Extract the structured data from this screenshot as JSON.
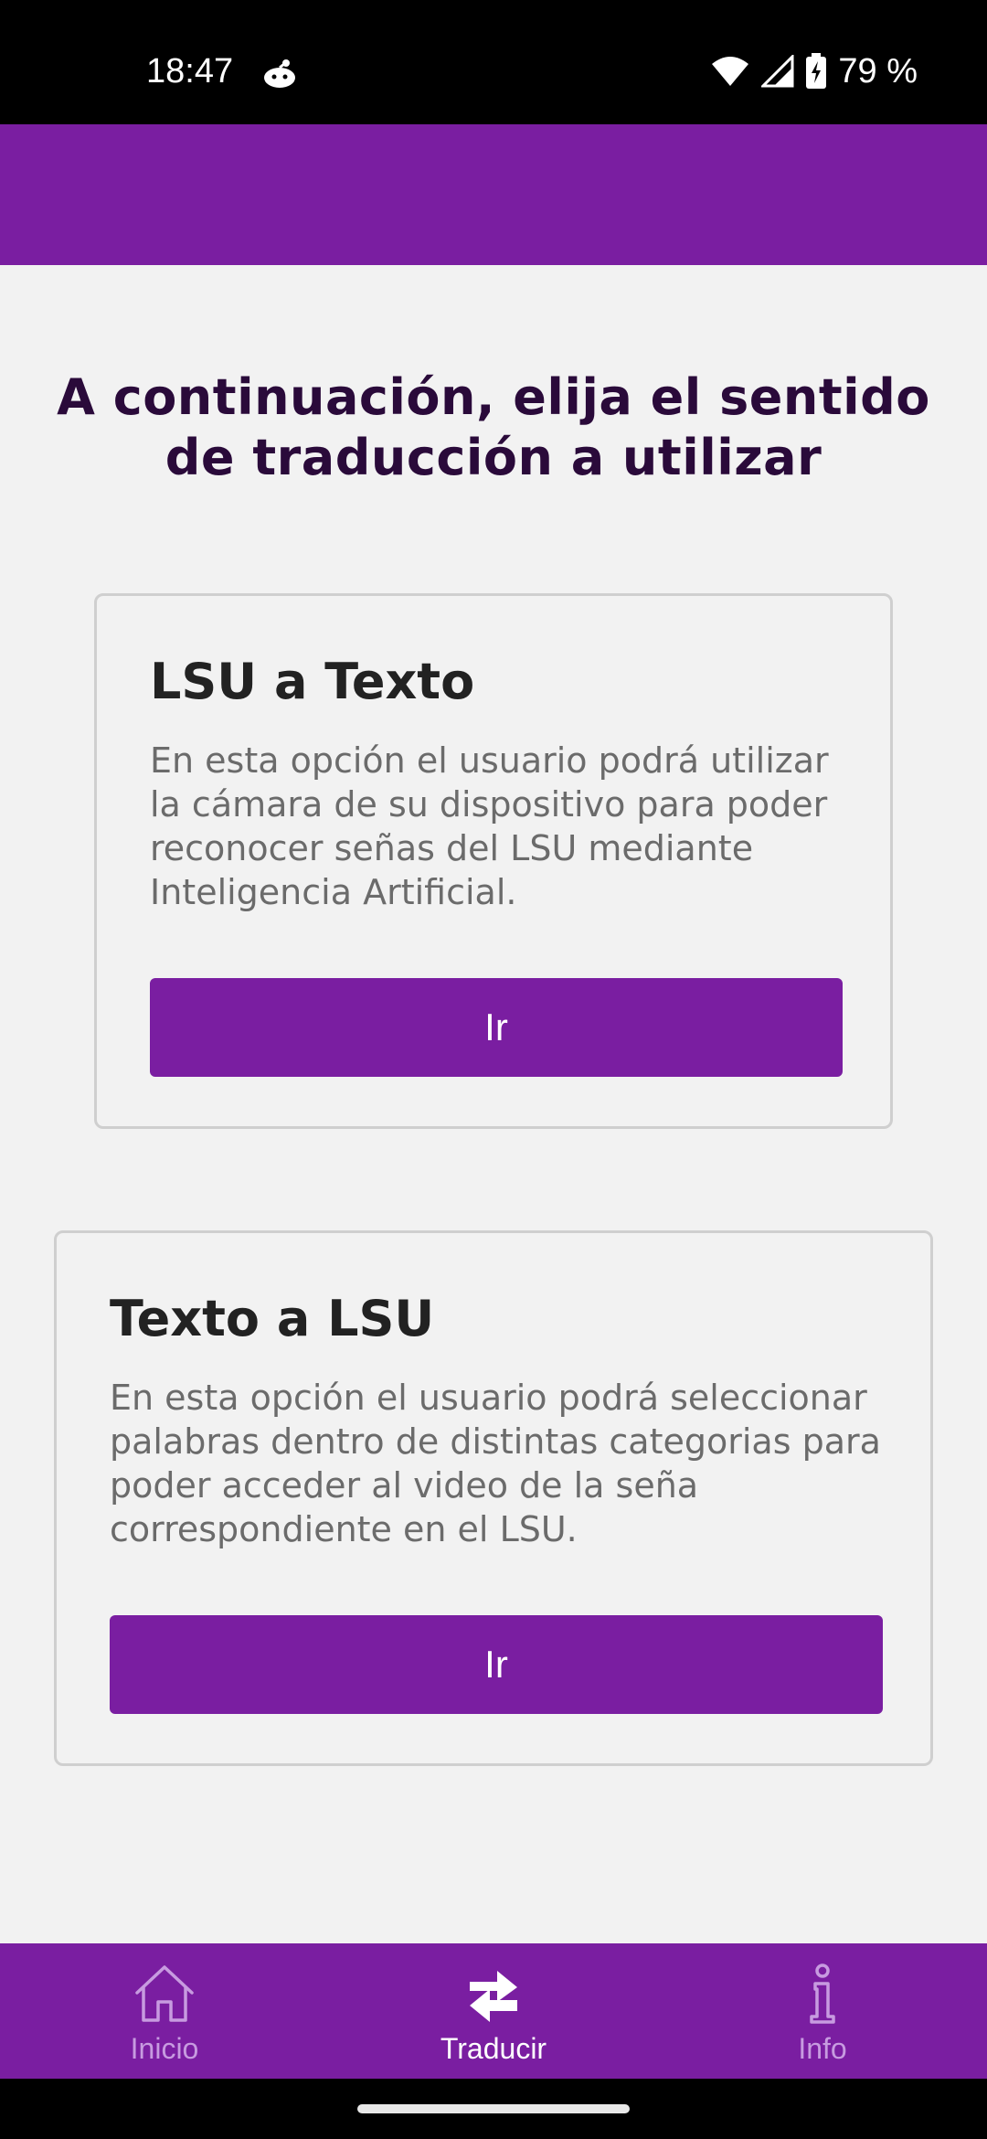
{
  "status_bar": {
    "time": "18:47",
    "battery": "79 %",
    "icons": [
      "notification-icon",
      "wifi-icon",
      "signal-icon",
      "battery-charging-icon"
    ]
  },
  "page": {
    "title": "A continuación, elija el sentido de traducción a utilizar"
  },
  "options": [
    {
      "title": "LSU a Texto",
      "description": "En esta opción el usuario podrá utilizar la cámara de su dispositivo para poder reconocer señas del LSU mediante Inteligencia Artificial.",
      "button_label": "Ir"
    },
    {
      "title": "Texto a LSU",
      "description": "En esta opción el usuario podrá seleccionar palabras dentro de distintas categorias para poder acceder al video de la seña correspondiente en el LSU.",
      "button_label": "Ir"
    }
  ],
  "bottom_nav": {
    "items": [
      {
        "label": "Inicio",
        "icon": "home-icon",
        "active": false
      },
      {
        "label": "Traducir",
        "icon": "swap-arrows-icon",
        "active": true
      },
      {
        "label": "Info",
        "icon": "info-icon",
        "active": false
      }
    ]
  },
  "colors": {
    "primary": "#7a1ea1",
    "title_text": "#2a0a3a",
    "background": "#f2f2f2",
    "inactive_nav": "#c79be0"
  }
}
